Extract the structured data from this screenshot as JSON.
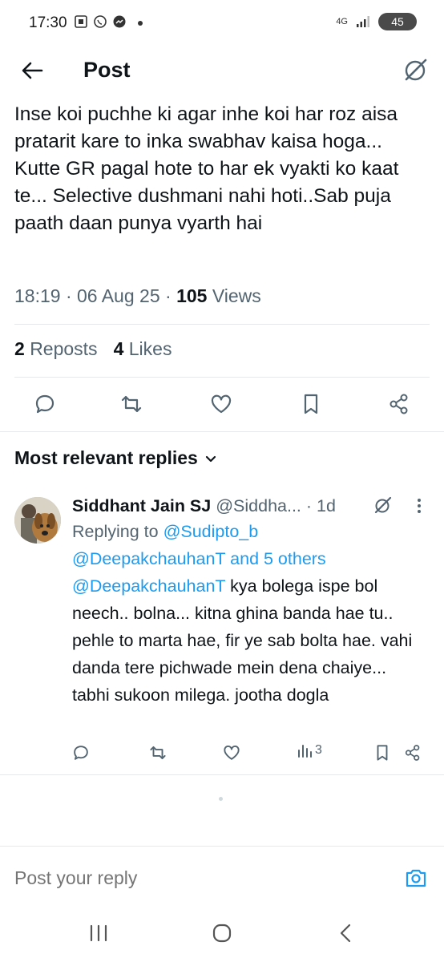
{
  "status_bar": {
    "time": "17:30",
    "network": "4G",
    "battery": "45"
  },
  "header": {
    "title": "Post"
  },
  "post": {
    "text": "Inse koi puchhe ki agar inhe koi har roz aisa pratarit kare to inka swabhav kaisa hoga... Kutte GR pagal hote to har ek vyakti ko kaat te... Selective dushmani nahi hoti..Sab puja paath daan punya vyarth hai",
    "time": "18:19",
    "date": "06 Aug 25",
    "views_count": "105",
    "views_label": "Views",
    "reposts_count": "2",
    "reposts_label": "Reposts",
    "likes_count": "4",
    "likes_label": "Likes"
  },
  "replies_section": {
    "title": "Most relevant replies"
  },
  "reply": {
    "name": "Siddhant Jain SJ",
    "handle": "@Siddha...",
    "age": "1d",
    "replying_prefix": "Replying to",
    "replying_to_1": "@Sudipto_b",
    "replying_to_2": "@DeepakchauhanT",
    "replying_suffix": "and 5 others",
    "mention": "@DeepakchauhanT",
    "body": "kya bolega ispe bol neech.. bolna... kitna ghina banda hae tu.. pehle to marta hae, fir ye sab bolta hae. vahi danda tere pichwade mein dena chaiye... tabhi sukoon milega. jootha dogla",
    "views": "3"
  },
  "composer": {
    "placeholder": "Post your reply"
  },
  "colors": {
    "accent": "#1d9bf0",
    "text_primary": "#0f1419",
    "text_secondary": "#536471"
  }
}
